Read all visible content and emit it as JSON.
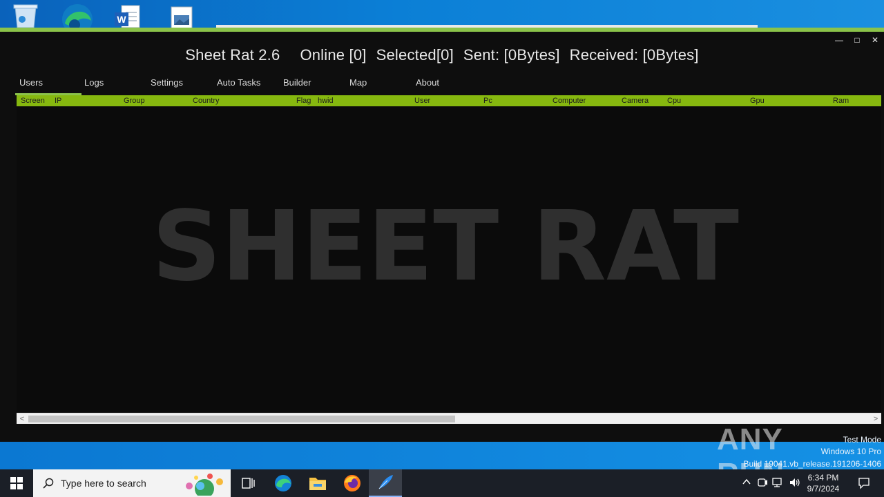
{
  "window": {
    "app_title": "Sheet Rat 2.6",
    "online": "Online [0]",
    "selected": "Selected[0]",
    "sent": "Sent: [0Bytes]",
    "received": "Received: [0Bytes]",
    "minimize": "—",
    "maximize": "□",
    "close": "✕"
  },
  "menu": {
    "tabs": [
      "Users",
      "Logs",
      "Settings",
      "Auto Tasks",
      "Builder",
      "Map",
      "About"
    ],
    "active": "Users"
  },
  "grid": {
    "columns": [
      "Screen",
      "IP",
      "Group",
      "Country",
      "Flag",
      "hwid",
      "User",
      "Pc",
      "Computer",
      "Camera",
      "Cpu",
      "Gpu",
      "Ram"
    ],
    "rows": []
  },
  "watermark_text": "SHEET RAT",
  "scrollbar": {
    "left_arrow": "<",
    "right_arrow": ">"
  },
  "overlay": {
    "test_mode": "Test Mode",
    "os": "Windows 10 Pro",
    "build": "Build 19041.vb_release.191206-1406",
    "brand": "ANY RUN"
  },
  "taskbar": {
    "search_placeholder": "Type here to search",
    "time": "6:34 PM",
    "date": "9/7/2024"
  },
  "colors": {
    "accent_green": "#86b80f",
    "app_bg": "#0e0e0e",
    "desktop_blue": "#0a78d0"
  }
}
